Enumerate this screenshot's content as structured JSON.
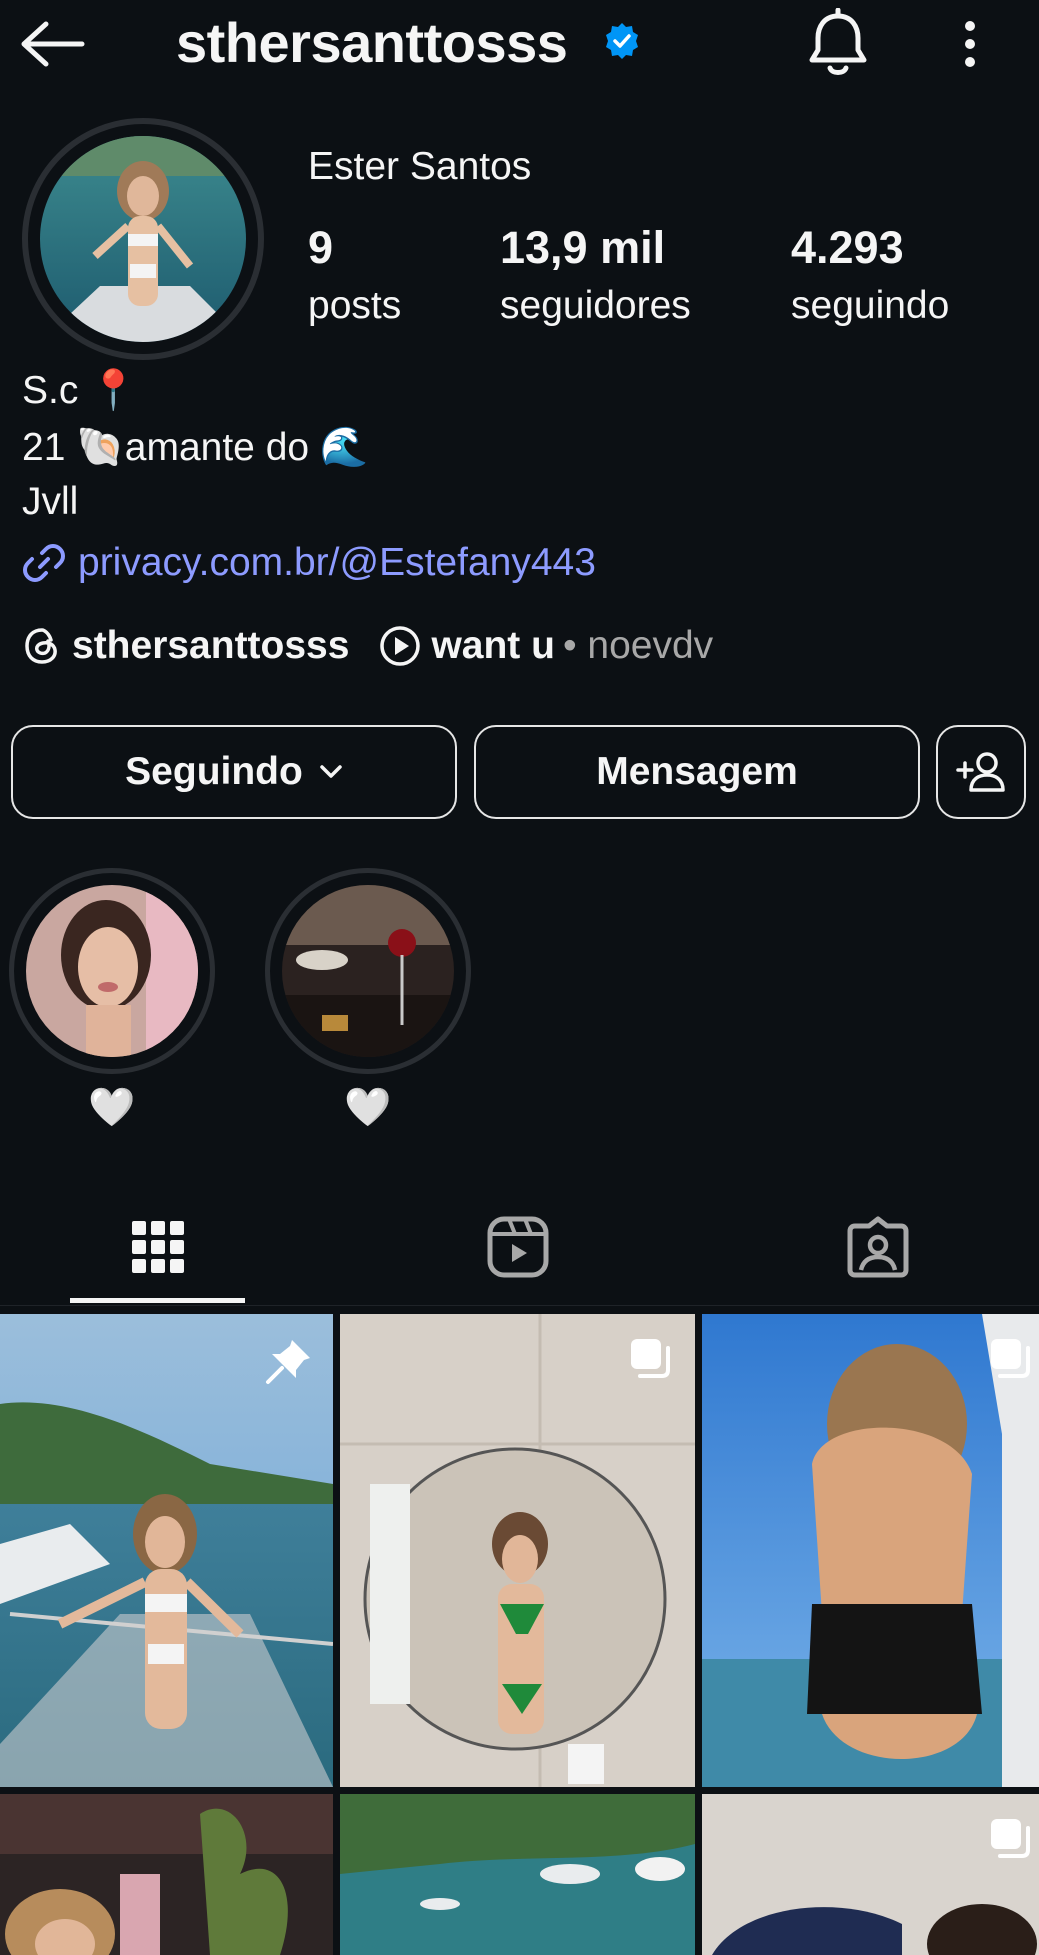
{
  "header": {
    "username": "sthersanttosss",
    "verified": true,
    "icons": [
      "back-arrow-icon",
      "verified-badge-icon",
      "bell-icon",
      "kebab-menu-icon"
    ]
  },
  "profile": {
    "full_name": "Ester Santos",
    "stats": [
      {
        "value": "9",
        "label": "posts"
      },
      {
        "value": "13,9 mil",
        "label": "seguidores"
      },
      {
        "value": "4.293",
        "label": "seguindo"
      }
    ],
    "bio": [
      "S.c 📍",
      "21 🐚amante do 🌊",
      "Jvll"
    ],
    "link": "privacy.com.br/@Estefany443",
    "threads_handle": "sthersanttosss",
    "song_title": "want u",
    "song_artist": "• noevdv"
  },
  "actions": {
    "following_label": "Seguindo",
    "message_label": "Mensagem"
  },
  "highlights": [
    {
      "label": "🤍"
    },
    {
      "label": "🤍"
    }
  ],
  "tabs": [
    "grid-icon",
    "reels-icon",
    "tagged-icon"
  ],
  "colors": {
    "background": "#0c1014",
    "link": "#8d9bff",
    "verified": "#0095f6",
    "muted": "#a8a8a8"
  }
}
